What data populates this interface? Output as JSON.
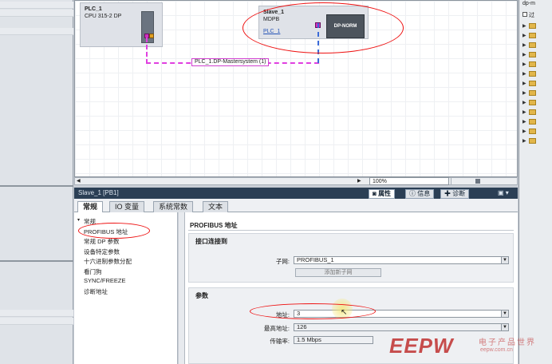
{
  "devices": {
    "plc": {
      "name": "PLC_1",
      "type": "CPU 315-2 DP"
    },
    "slave": {
      "name": "Slave_1",
      "type": "MDPB",
      "link": "PLC_1",
      "module": "DP-NORM"
    }
  },
  "network": {
    "label": "PLC_1.DP-Mastersystem (1)"
  },
  "canvas": {
    "zoom": "100%"
  },
  "right_panel": {
    "title": "dp-m",
    "option_label": "过"
  },
  "inspector": {
    "title": "Slave_1 [PB1]",
    "tabs_right": {
      "properties": "属性",
      "info": "信息",
      "diagnostics": "诊断"
    },
    "tabs": [
      "常规",
      "IO 变量",
      "系统常数",
      "文本"
    ],
    "nav": [
      "常规",
      "PROFIBUS 地址",
      "常规 DP 参数",
      "设备特定参数",
      "十六进制参数分配",
      "看门狗",
      "SYNC/FREEZE",
      "诊断地址"
    ],
    "form": {
      "title": "PROFIBUS 地址",
      "interface_section": "接口连接到",
      "subnet_label": "子网:",
      "subnet_value": "PROFIBUS_1",
      "add_subnet_button": "添加新子网",
      "params_section": "参数",
      "address_label": "地址:",
      "address_value": "3",
      "max_address_label": "最高地址:",
      "max_address_value": "126",
      "baud_label": "传输率:",
      "baud_value": "1.5 Mbps"
    }
  },
  "watermark": {
    "logo": "EEPW",
    "cn": "电子产品世界",
    "url": "eepw.com.cn"
  }
}
